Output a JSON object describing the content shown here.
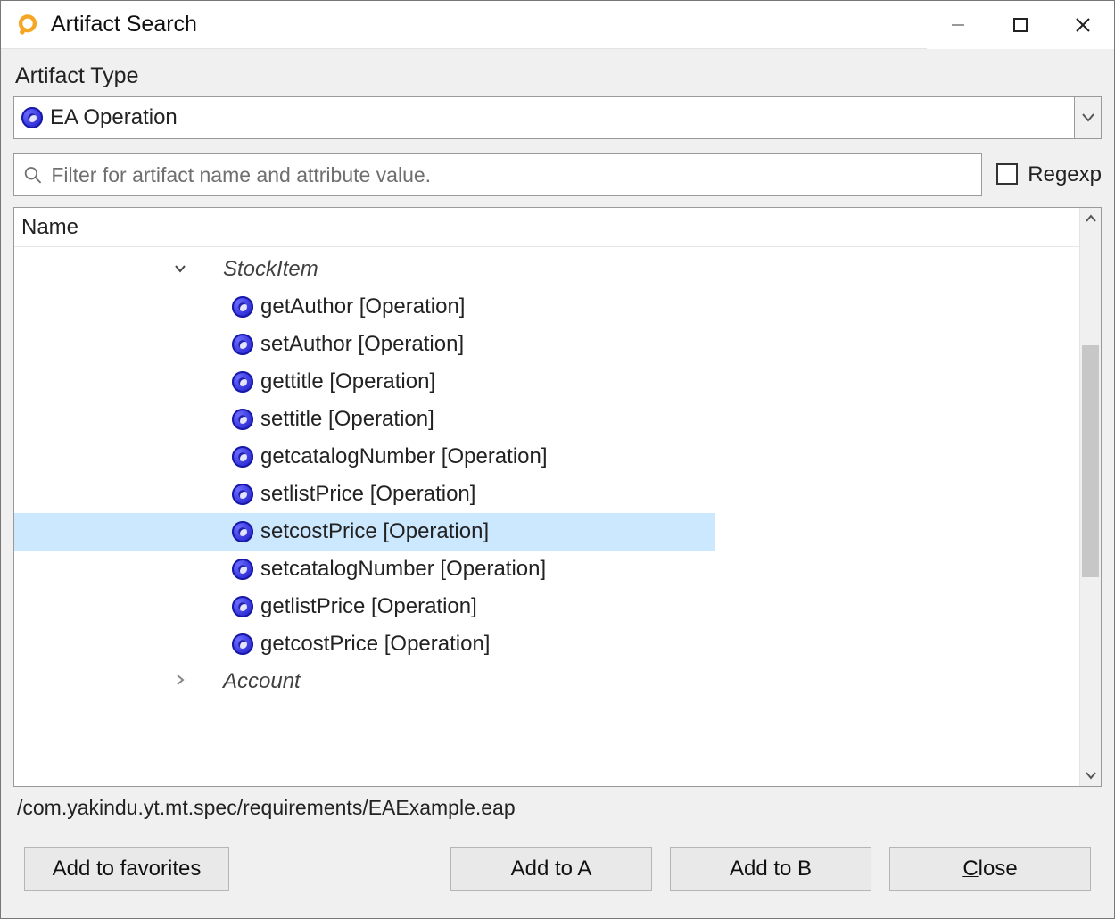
{
  "window": {
    "title": "Artifact Search"
  },
  "section": {
    "artifact_type_label": "Artifact Type",
    "artifact_type_value": "EA Operation",
    "filter_placeholder": "Filter for artifact name and attribute value.",
    "regexp_label": "Regexp",
    "regexp_checked": false
  },
  "tree": {
    "column_header": "Name",
    "groups": [
      {
        "name": "StockItem",
        "expanded": true,
        "items": [
          {
            "label": "getAuthor [Operation]",
            "selected": false
          },
          {
            "label": "setAuthor [Operation]",
            "selected": false
          },
          {
            "label": "gettitle [Operation]",
            "selected": false
          },
          {
            "label": "settitle [Operation]",
            "selected": false
          },
          {
            "label": "getcatalogNumber [Operation]",
            "selected": false
          },
          {
            "label": "setlistPrice [Operation]",
            "selected": false
          },
          {
            "label": "setcostPrice [Operation]",
            "selected": true
          },
          {
            "label": "setcatalogNumber [Operation]",
            "selected": false
          },
          {
            "label": "getlistPrice [Operation]",
            "selected": false
          },
          {
            "label": "getcostPrice [Operation]",
            "selected": false
          }
        ]
      },
      {
        "name": "Account",
        "expanded": false,
        "items": []
      }
    ]
  },
  "status_path": "/com.yakindu.yt.mt.spec/requirements/EAExample.eap",
  "buttons": {
    "favorites": "Add to favorites",
    "add_a": "Add to A",
    "add_b": "Add to B",
    "close_prefix": "C",
    "close_rest": "lose"
  }
}
